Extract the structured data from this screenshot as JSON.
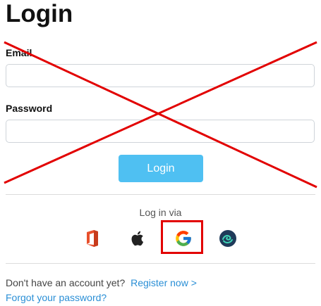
{
  "page": {
    "title": "Login"
  },
  "form": {
    "email_label": "Email",
    "email_value": "",
    "password_label": "Password",
    "password_value": "",
    "login_button": "Login"
  },
  "social": {
    "caption": "Log in via",
    "providers": [
      {
        "icon": "office-icon"
      },
      {
        "icon": "apple-icon"
      },
      {
        "icon": "google-icon",
        "highlighted": true
      },
      {
        "icon": "circular-logo-icon"
      }
    ]
  },
  "footer": {
    "no_account_text": "Don't have an account yet?",
    "register_link": "Register now >",
    "forgot_link": "Forgot your password?"
  },
  "annotations": {
    "cross_color": "#e20000",
    "highlight_color": "#e20000"
  },
  "colors": {
    "accent": "#4fc0f2",
    "link": "#2a8fd6"
  }
}
